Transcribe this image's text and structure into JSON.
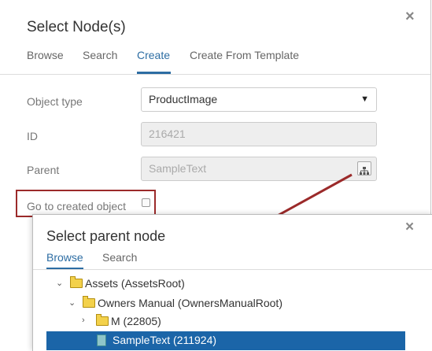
{
  "dialog": {
    "title": "Select Node(s)",
    "close_glyph": "×",
    "tabs": [
      {
        "label": "Browse",
        "active": false
      },
      {
        "label": "Search",
        "active": false
      },
      {
        "label": "Create",
        "active": true
      },
      {
        "label": "Create From Template",
        "active": false
      }
    ],
    "fields": {
      "object_type": {
        "label": "Object type",
        "value": "ProductImage",
        "caret": "▼"
      },
      "id": {
        "label": "ID",
        "value": "216421"
      },
      "parent": {
        "label": "Parent",
        "value": "SampleText",
        "picker_icon": "hierarchy-icon"
      }
    },
    "go_to_created": {
      "label": "Go to created object",
      "checked": false
    }
  },
  "parent_dialog": {
    "title": "Select parent node",
    "close_glyph": "×",
    "tabs": [
      {
        "label": "Browse",
        "active": true
      },
      {
        "label": "Search",
        "active": false
      }
    ],
    "tree": [
      {
        "label": "Assets (AssetsRoot)",
        "chevron": "⌄",
        "icon": "folder-icon"
      },
      {
        "label": "Owners Manual (OwnersManualRoot)",
        "chevron": "⌄",
        "icon": "folder-icon"
      },
      {
        "label": "M (22805)",
        "chevron": "›",
        "icon": "folder-icon"
      },
      {
        "label": "SampleText (211924)",
        "chevron": "",
        "icon": "text-document-icon",
        "selected": true
      }
    ]
  },
  "colors": {
    "accent": "#2d6da3",
    "selection": "#1b65a8",
    "annotation": "#9b2a2a"
  }
}
